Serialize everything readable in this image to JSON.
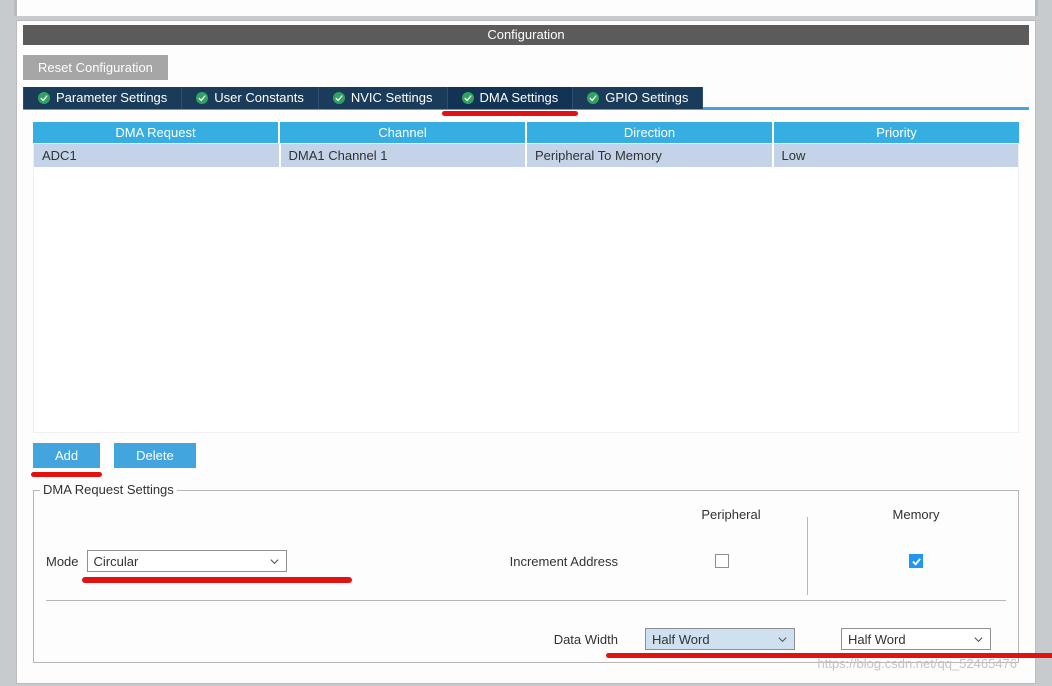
{
  "title": "Configuration",
  "reset_label": "Reset Configuration",
  "tabs": [
    {
      "label": "Parameter Settings"
    },
    {
      "label": "User Constants"
    },
    {
      "label": "NVIC Settings"
    },
    {
      "label": "DMA Settings"
    },
    {
      "label": "GPIO Settings"
    }
  ],
  "table": {
    "headers": [
      "DMA Request",
      "Channel",
      "Direction",
      "Priority"
    ],
    "rows": [
      {
        "request": "ADC1",
        "channel": "DMA1 Channel 1",
        "direction": "Peripheral To Memory",
        "priority": "Low"
      }
    ]
  },
  "buttons": {
    "add": "Add",
    "delete": "Delete"
  },
  "fieldset": {
    "legend": "DMA Request Settings",
    "mode_label": "Mode",
    "mode_value": "Circular",
    "col_peripheral": "Peripheral",
    "col_memory": "Memory",
    "increment_label": "Increment Address",
    "increment_peripheral": false,
    "increment_memory": true,
    "data_width_label": "Data Width",
    "data_width_peripheral": "Half Word",
    "data_width_memory": "Half Word"
  },
  "watermark": "https://blog.csdn.net/qq_52465476"
}
